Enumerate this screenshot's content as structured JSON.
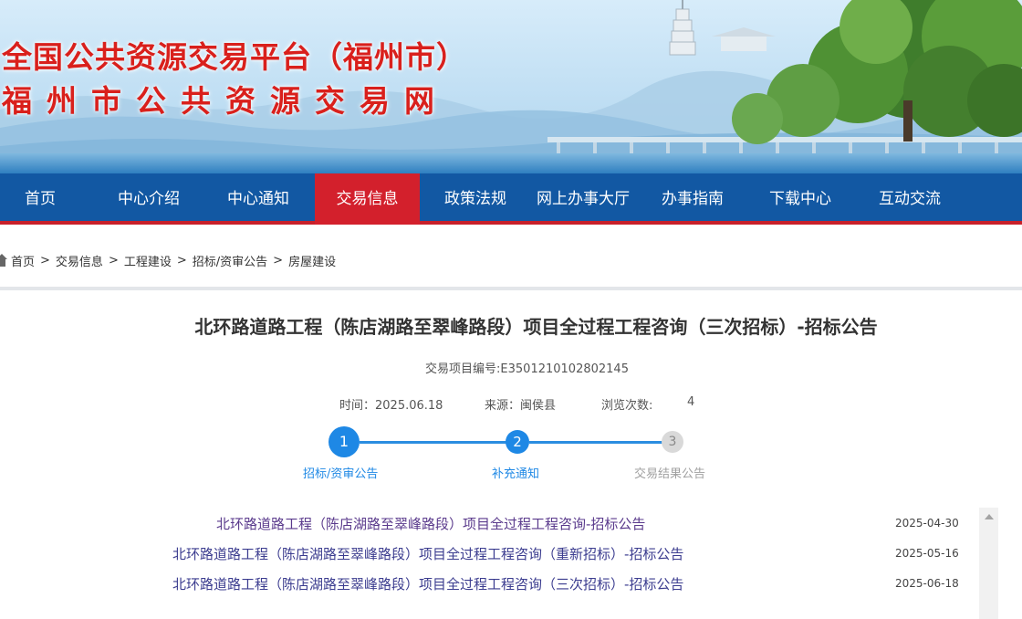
{
  "banner": {
    "title_line1": "全国公共资源交易平台（福州市）",
    "title_line2": "福州市公共资源交易网"
  },
  "nav": {
    "items": [
      {
        "label": "首页"
      },
      {
        "label": "中心介绍"
      },
      {
        "label": "中心通知"
      },
      {
        "label": "交易信息",
        "active": true
      },
      {
        "label": "政策法规"
      },
      {
        "label": "网上办事大厅"
      },
      {
        "label": "办事指南"
      },
      {
        "label": "下载中心"
      },
      {
        "label": "互动交流"
      }
    ],
    "accent": "#1258a3",
    "active_color": "#d3202c"
  },
  "breadcrumb": {
    "items": [
      "首页",
      "交易信息",
      "工程建设",
      "招标/资审公告",
      "房屋建设"
    ],
    "separator": ">"
  },
  "article": {
    "title": "北环路道路工程（陈店湖路至翠峰路段）项目全过程工程咨询（三次招标）-招标公告",
    "project_no": "交易项目编号:E3501210102802145",
    "time_label": "时间：",
    "time_value": "2025.06.18",
    "source_label": "来源：",
    "source_value": "闽侯县",
    "views_label": "浏览次数:",
    "views_value": "4"
  },
  "steps": [
    {
      "num": "1",
      "label": "招标/资审公告",
      "state": "done"
    },
    {
      "num": "2",
      "label": "补充通知",
      "state": "done"
    },
    {
      "num": "3",
      "label": "交易结果公告",
      "state": "pending"
    }
  ],
  "related": [
    {
      "title": "北环路道路工程（陈店湖路至翠峰路段）项目全过程工程咨询-招标公告",
      "date": "2025-04-30"
    },
    {
      "title": "北环路道路工程（陈店湖路至翠峰路段）项目全过程工程咨询（重新招标）-招标公告",
      "date": "2025-05-16"
    },
    {
      "title": "北环路道路工程（陈店湖路至翠峰路段）项目全过程工程咨询（三次招标）-招标公告",
      "date": "2025-06-18"
    }
  ]
}
